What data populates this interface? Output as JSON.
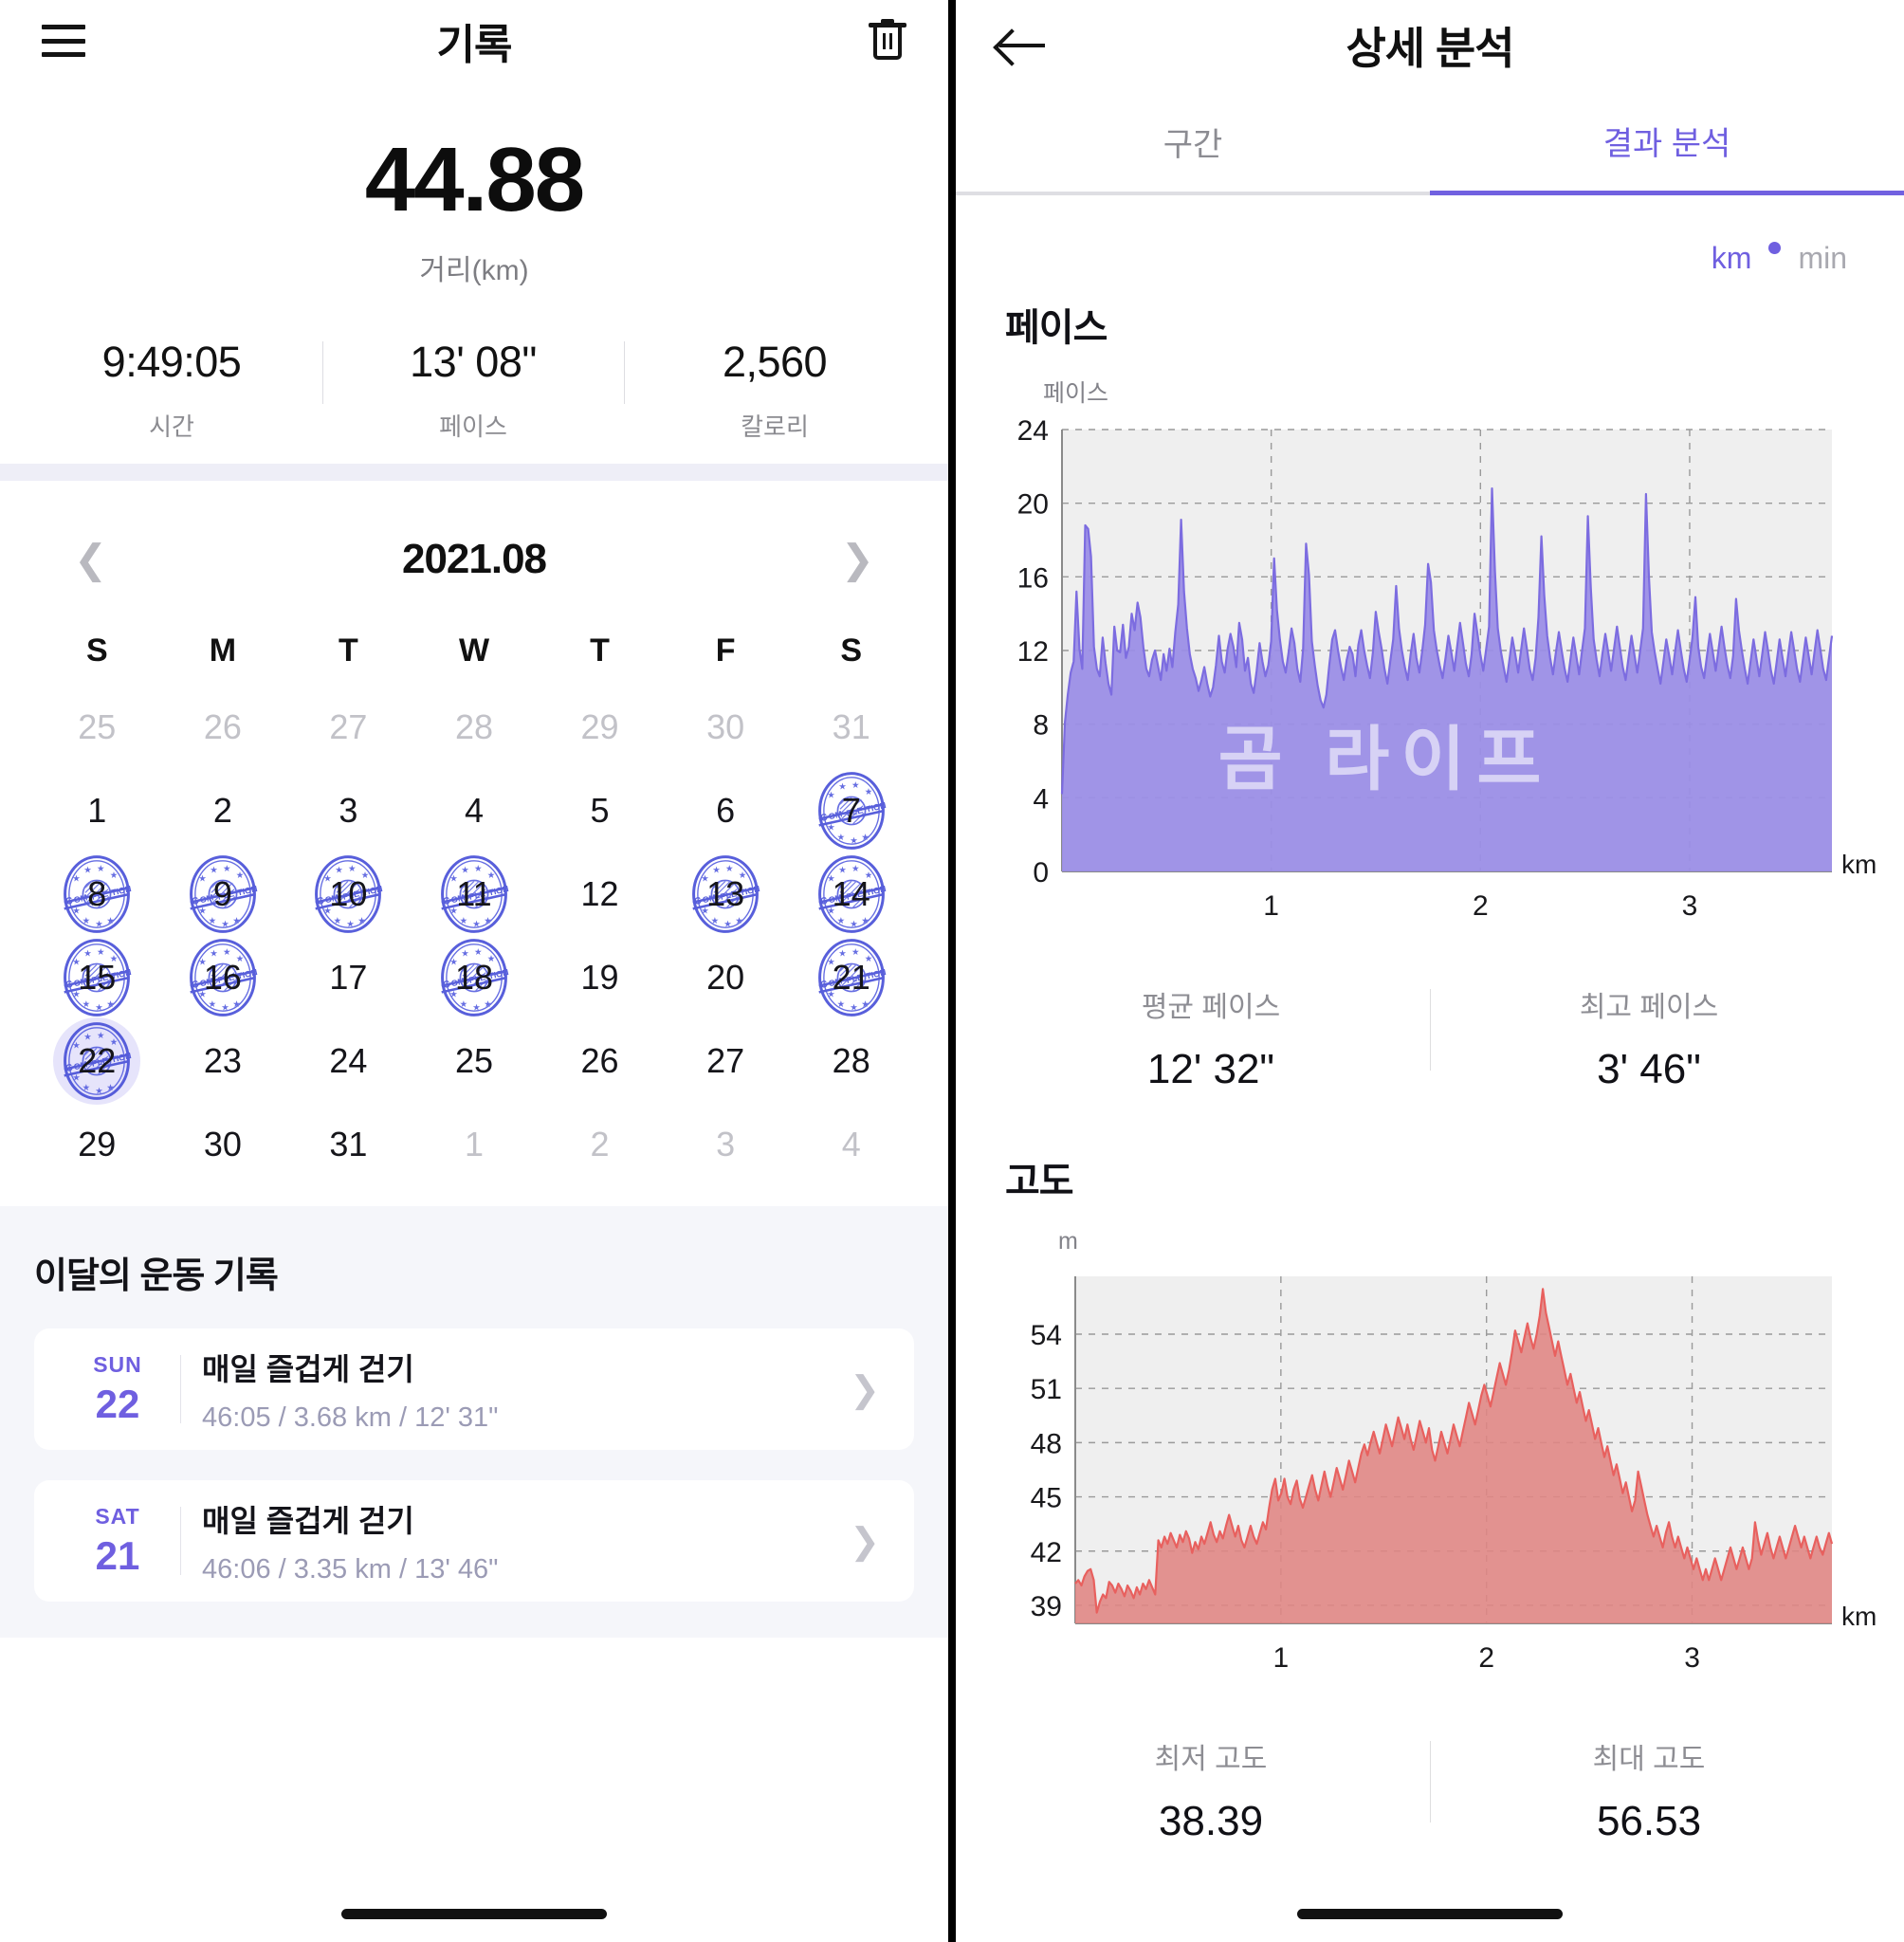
{
  "colors": {
    "accent": "#6f5fe0",
    "pace_line": "#7c6ce0",
    "pace_fill": "#9b8ee6",
    "elev_line": "#e8605e",
    "elev_fill": "#e08583",
    "plot_bg": "#efefef"
  },
  "left": {
    "topbar": {
      "title": "기록",
      "menu_icon": "hamburger-icon",
      "delete_icon": "trash-icon"
    },
    "summary": {
      "distance_value": "44.88",
      "distance_label": "거리(km)",
      "stats": [
        {
          "value": "9:49:05",
          "label": "시간"
        },
        {
          "value": "13' 08\"",
          "label": "페이스"
        },
        {
          "value": "2,560",
          "label": "칼로리"
        }
      ]
    },
    "calendar": {
      "month": "2021.08",
      "prev_icon": "chevron-left-icon",
      "next_icon": "chevron-right-icon",
      "dow": [
        "S",
        "M",
        "T",
        "W",
        "T",
        "F",
        "S"
      ],
      "stamp_text": "COMPLETION",
      "weeks": [
        [
          {
            "n": "25",
            "muted": true
          },
          {
            "n": "26",
            "muted": true
          },
          {
            "n": "27",
            "muted": true
          },
          {
            "n": "28",
            "muted": true
          },
          {
            "n": "29",
            "muted": true
          },
          {
            "n": "30",
            "muted": true
          },
          {
            "n": "31",
            "muted": true
          }
        ],
        [
          {
            "n": "1"
          },
          {
            "n": "2"
          },
          {
            "n": "3"
          },
          {
            "n": "4"
          },
          {
            "n": "5"
          },
          {
            "n": "6"
          },
          {
            "n": "7",
            "stamp": true
          }
        ],
        [
          {
            "n": "8",
            "stamp": true
          },
          {
            "n": "9",
            "stamp": true
          },
          {
            "n": "10",
            "stamp": true
          },
          {
            "n": "11",
            "stamp": true
          },
          {
            "n": "12"
          },
          {
            "n": "13",
            "stamp": true
          },
          {
            "n": "14",
            "stamp": true
          }
        ],
        [
          {
            "n": "15",
            "stamp": true
          },
          {
            "n": "16",
            "stamp": true
          },
          {
            "n": "17"
          },
          {
            "n": "18",
            "stamp": true
          },
          {
            "n": "19"
          },
          {
            "n": "20"
          },
          {
            "n": "21",
            "stamp": true
          }
        ],
        [
          {
            "n": "22",
            "stamp": true,
            "selected": true
          },
          {
            "n": "23"
          },
          {
            "n": "24"
          },
          {
            "n": "25"
          },
          {
            "n": "26"
          },
          {
            "n": "27"
          },
          {
            "n": "28"
          }
        ],
        [
          {
            "n": "29"
          },
          {
            "n": "30"
          },
          {
            "n": "31"
          },
          {
            "n": "1",
            "muted": true
          },
          {
            "n": "2",
            "muted": true
          },
          {
            "n": "3",
            "muted": true
          },
          {
            "n": "4",
            "muted": true
          }
        ]
      ]
    },
    "records": {
      "title": "이달의 운동 기록",
      "items": [
        {
          "dow": "SUN",
          "day": "22",
          "title": "매일 즐겁게 걷기",
          "detail": "46:05 / 3.68 km / 12' 31\"",
          "chevron": "chevron-right-icon"
        },
        {
          "dow": "SAT",
          "day": "21",
          "title": "매일 즐겁게 걷기",
          "detail": "46:06 / 3.35 km / 13' 46\"",
          "chevron": "chevron-right-icon"
        }
      ]
    }
  },
  "right": {
    "topbar": {
      "title": "상세 분석",
      "back_icon": "arrow-left-icon"
    },
    "tabs": [
      {
        "label": "구간",
        "active": false
      },
      {
        "label": "결과 분석",
        "active": true
      }
    ],
    "unit_toggle": {
      "left": "km",
      "right": "min",
      "active": "km"
    },
    "pace_section": {
      "title": "페이스",
      "avg": {
        "label": "평균 페이스",
        "value": "12' 32\""
      },
      "best": {
        "label": "최고 페이스",
        "value": "3' 46\""
      }
    },
    "elev_section": {
      "title": "고도",
      "min": {
        "label": "최저 고도",
        "value": "38.39"
      },
      "max": {
        "label": "최대 고도",
        "value": "56.53"
      }
    },
    "watermark": "곰 라이프"
  },
  "chart_data": [
    {
      "type": "area",
      "id": "pace",
      "title": "페이스",
      "ylabel": "페이스",
      "xlabel": "km",
      "yticks": [
        0,
        4,
        8,
        12,
        16,
        20,
        24
      ],
      "ylim": [
        0,
        24
      ],
      "xticks": [
        1,
        2,
        3
      ],
      "xlim": [
        0,
        3.68
      ],
      "grid": true,
      "legend": null,
      "annotations": [
        "곰 라이프"
      ],
      "series_color": "#7c6ce0",
      "summary": {
        "avg_pace": "12' 32\"",
        "best_pace": "3' 46\""
      },
      "values": [
        4.2,
        8.1,
        9.6,
        10.8,
        11.4,
        15.2,
        12.1,
        11.0,
        18.8,
        18.6,
        17.1,
        12.2,
        11.0,
        10.6,
        12.7,
        11.3,
        10.2,
        9.6,
        13.3,
        12.0,
        11.9,
        13.4,
        11.6,
        12.2,
        14.0,
        13.1,
        14.6,
        13.8,
        12.2,
        11.0,
        10.6,
        11.5,
        12.0,
        11.2,
        10.4,
        11.8,
        10.9,
        12.1,
        11.1,
        13.0,
        14.5,
        19.1,
        15.2,
        13.2,
        11.8,
        11.0,
        10.5,
        9.8,
        10.4,
        11.1,
        10.2,
        9.5,
        10.0,
        11.2,
        12.8,
        11.4,
        10.8,
        12.1,
        12.9,
        12.2,
        11.1,
        13.5,
        12.6,
        10.9,
        11.6,
        10.2,
        9.7,
        10.9,
        12.4,
        11.4,
        10.6,
        11.2,
        12.5,
        17.0,
        14.2,
        12.6,
        11.4,
        10.8,
        11.9,
        13.2,
        12.4,
        11.0,
        10.3,
        12.1,
        17.8,
        16.1,
        12.5,
        11.2,
        10.1,
        9.3,
        8.9,
        9.6,
        11.2,
        12.6,
        13.1,
        12.0,
        11.1,
        10.4,
        11.5,
        12.2,
        11.8,
        10.6,
        12.3,
        13.1,
        12.0,
        11.2,
        10.5,
        11.9,
        14.1,
        13.0,
        12.1,
        11.0,
        10.2,
        11.4,
        12.6,
        15.5,
        13.2,
        12.0,
        11.1,
        10.4,
        11.8,
        12.9,
        11.6,
        10.8,
        12.0,
        13.4,
        16.7,
        15.7,
        13.1,
        12.0,
        11.2,
        10.5,
        11.6,
        12.8,
        11.9,
        10.9,
        12.2,
        13.5,
        12.4,
        11.3,
        10.6,
        11.8,
        14.0,
        12.9,
        11.8,
        10.9,
        12.1,
        13.3,
        20.8,
        16.3,
        13.2,
        12.0,
        11.1,
        10.3,
        11.5,
        12.7,
        11.8,
        10.8,
        12.0,
        13.2,
        12.1,
        11.0,
        10.4,
        11.6,
        13.8,
        18.2,
        15.0,
        12.8,
        11.6,
        10.7,
        11.9,
        13.0,
        12.0,
        11.0,
        10.3,
        11.5,
        12.7,
        11.7,
        10.7,
        12.0,
        13.2,
        19.3,
        15.4,
        12.6,
        11.5,
        10.6,
        11.8,
        12.9,
        11.9,
        10.9,
        12.1,
        13.3,
        12.2,
        11.1,
        10.4,
        11.6,
        12.8,
        11.8,
        10.8,
        12.0,
        13.2,
        20.5,
        16.0,
        13.0,
        11.9,
        11.0,
        10.2,
        11.4,
        12.6,
        11.7,
        10.7,
        11.9,
        13.1,
        12.0,
        11.0,
        10.3,
        11.5,
        12.7,
        14.9,
        12.2,
        11.1,
        10.5,
        11.7,
        12.9,
        11.9,
        10.9,
        12.1,
        13.3,
        12.2,
        11.2,
        10.5,
        11.7,
        14.8,
        13.1,
        12.0,
        11.0,
        10.2,
        11.4,
        12.6,
        11.6,
        10.6,
        11.8,
        13.0,
        12.0,
        10.9,
        10.2,
        11.4,
        12.6,
        11.6,
        10.6,
        11.8,
        13.0,
        12.0,
        11.0,
        10.3,
        11.5,
        12.7,
        11.7,
        10.7,
        11.9,
        13.1,
        12.1,
        11.0,
        10.4,
        11.6,
        12.8
      ]
    },
    {
      "type": "area",
      "id": "elevation",
      "title": "고도",
      "ylabel": "m",
      "xlabel": "km",
      "yticks": [
        39,
        42,
        45,
        48,
        51,
        54
      ],
      "ylim": [
        38.0,
        57.2
      ],
      "xticks": [
        1,
        2,
        3
      ],
      "xlim": [
        0,
        3.68
      ],
      "grid": true,
      "series_color": "#e8605e",
      "summary": {
        "min_elevation": "38.39",
        "max_elevation": "56.53"
      },
      "values": [
        40.2,
        40.4,
        40.1,
        40.6,
        40.9,
        41.0,
        40.4,
        38.6,
        39.2,
        39.6,
        39.4,
        40.3,
        40.1,
        39.7,
        40.2,
        39.9,
        39.5,
        40.1,
        39.8,
        39.4,
        40.0,
        39.6,
        40.2,
        39.9,
        40.4,
        40.0,
        39.6,
        42.6,
        42.2,
        42.8,
        42.4,
        43.0,
        42.6,
        42.2,
        42.9,
        42.5,
        43.1,
        42.7,
        41.9,
        42.5,
        42.1,
        42.8,
        42.4,
        43.0,
        43.6,
        42.9,
        42.5,
        43.1,
        42.7,
        43.4,
        44.0,
        43.4,
        42.8,
        43.4,
        42.6,
        42.2,
        42.8,
        43.4,
        42.8,
        42.4,
        43.0,
        43.6,
        43.2,
        44.4,
        45.4,
        46.0,
        44.8,
        45.2,
        46.0,
        45.0,
        44.6,
        45.4,
        45.9,
        44.9,
        44.4,
        45.0,
        45.6,
        46.2,
        45.4,
        44.8,
        45.6,
        46.4,
        45.6,
        45.0,
        45.8,
        46.6,
        46.0,
        45.4,
        46.2,
        47.0,
        46.4,
        45.8,
        46.6,
        47.4,
        47.9,
        47.3,
        48.0,
        48.6,
        48.0,
        47.4,
        48.2,
        49.0,
        48.4,
        47.8,
        48.6,
        49.4,
        48.8,
        48.2,
        49.0,
        48.2,
        47.6,
        48.4,
        49.2,
        48.6,
        48.0,
        48.8,
        47.6,
        47.0,
        47.8,
        48.6,
        48.0,
        47.4,
        48.2,
        49.0,
        48.4,
        47.8,
        48.6,
        49.4,
        50.2,
        49.6,
        49.0,
        49.8,
        50.6,
        51.2,
        50.6,
        50.0,
        50.8,
        51.6,
        52.4,
        51.8,
        51.2,
        52.0,
        53.0,
        54.2,
        53.6,
        53.0,
        53.8,
        54.6,
        53.8,
        53.2,
        54.0,
        55.0,
        56.5,
        55.2,
        54.4,
        53.6,
        52.8,
        53.6,
        52.8,
        52.0,
        51.2,
        51.8,
        51.0,
        50.2,
        50.8,
        50.0,
        49.2,
        49.8,
        49.0,
        48.2,
        48.8,
        48.0,
        47.2,
        47.8,
        47.0,
        46.2,
        46.8,
        46.0,
        45.2,
        45.8,
        45.0,
        44.2,
        44.8,
        46.4,
        45.6,
        44.8,
        44.0,
        43.4,
        42.8,
        43.4,
        42.8,
        42.2,
        43.0,
        43.6,
        42.8,
        42.2,
        42.8,
        42.2,
        41.6,
        42.2,
        41.6,
        41.0,
        41.6,
        41.0,
        40.4,
        41.0,
        40.4,
        41.0,
        41.6,
        41.0,
        40.4,
        41.0,
        41.6,
        42.2,
        41.6,
        41.0,
        41.6,
        42.2,
        41.6,
        41.0,
        41.6,
        43.6,
        42.6,
        41.8,
        42.4,
        43.0,
        42.2,
        41.6,
        42.2,
        42.8,
        42.2,
        41.6,
        42.2,
        42.8,
        43.4,
        42.8,
        42.2,
        42.8,
        42.2,
        41.6,
        42.2,
        42.8,
        42.2,
        41.8,
        42.4,
        43.0,
        42.4
      ]
    }
  ]
}
